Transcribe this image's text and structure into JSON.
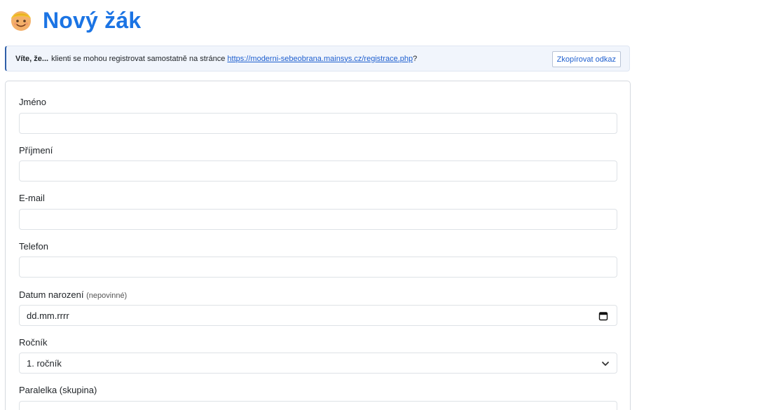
{
  "header": {
    "icon": "smiling-face-icon",
    "title": "Nový žák"
  },
  "info": {
    "strong": "Víte, že...",
    "text_before": "klienti se mohou registrovat samostatně na stránce",
    "link": "https://moderni-sebeobrana.mainsys.cz/registrace.php",
    "text_after": "?",
    "copy_button": "Zkopírovat odkaz"
  },
  "form": {
    "first_name": {
      "label": "Jméno",
      "value": ""
    },
    "last_name": {
      "label": "Příjmení",
      "value": ""
    },
    "email": {
      "label": "E-mail",
      "value": ""
    },
    "phone": {
      "label": "Telefon",
      "value": ""
    },
    "birth_date": {
      "label": "Datum narození",
      "optional": "(nepovinné)",
      "placeholder": "dd.mm.rrrr",
      "icon": "calendar-icon"
    },
    "grade": {
      "label": "Ročník",
      "selected": "1. ročník",
      "icon": "chevron-down-icon"
    },
    "group": {
      "label": "Paralelka (skupina)",
      "icon": "chevron-down-icon"
    }
  },
  "colors": {
    "title": "#1b74e4",
    "link": "#1e5fcf",
    "info_bg": "#f1f5fc",
    "info_accent": "#2f5fa8"
  }
}
